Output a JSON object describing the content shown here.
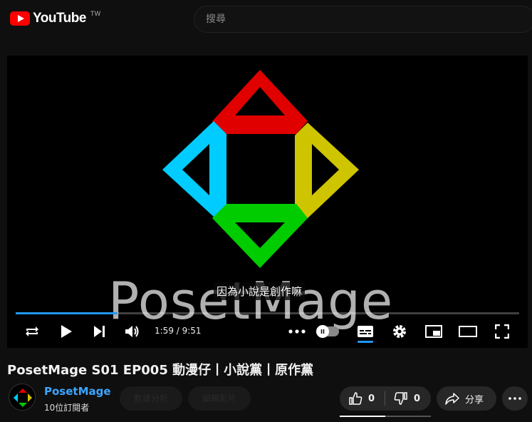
{
  "header": {
    "logo_text": "YouTube",
    "region": "TW",
    "search_placeholder": "搜尋"
  },
  "player": {
    "video_brand_text": "PosetMage",
    "subtitle": "因為小說是創作嘛",
    "time_current": "1:59",
    "time_total": "9:51",
    "time_display": "1:59 / 9:51",
    "progress_fraction": 0.202,
    "toggle_state": "paused",
    "accent_color": "#2196f3",
    "logo_colors": {
      "top": "#e00000",
      "right": "#cfc400",
      "bottom": "#00cc00",
      "left": "#00ccff"
    }
  },
  "video": {
    "title": "PosetMage S01 EP005 動漫仔丨小說黨丨原作黨"
  },
  "channel": {
    "name": "PosetMage",
    "subscribers": "10位訂閱者",
    "analytics_label": "數據分析",
    "edit_label": "編輯影片"
  },
  "actions": {
    "likes": "0",
    "dislikes": "0",
    "share_label": "分享",
    "like_ratio": 0.5
  }
}
